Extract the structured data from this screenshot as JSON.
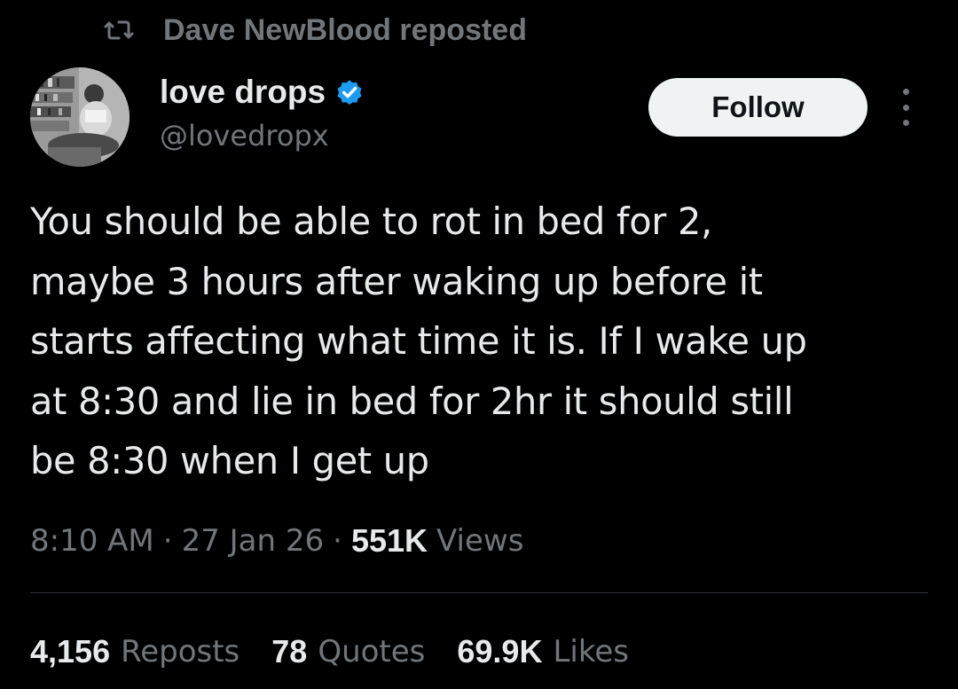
{
  "repost": {
    "icon": "repost-icon",
    "text": "Dave NewBlood reposted"
  },
  "author": {
    "name": "love drops",
    "handle": "@lovedropx",
    "verified": true,
    "verified_color": "#1d9bf0",
    "avatar_icon": "avatar-photo"
  },
  "follow_label": "Follow",
  "more_icon": "more-vertical-icon",
  "tweet": {
    "text": "You should be able to rot in bed for 2,\nmaybe 3 hours after waking up before it\nstarts affecting what time it is. If I wake up\nat 8:30 and lie in bed for 2hr it should still\nbe 8:30 when I get up"
  },
  "meta": {
    "time": "8:10 AM",
    "sep1": "·",
    "date": "27 Jan 26",
    "sep2": "·",
    "views_count": "551K",
    "views_label": "Views"
  },
  "stats": {
    "reposts_count": "4,156",
    "reposts_label": "Reposts",
    "quotes_count": "78",
    "quotes_label": "Quotes",
    "likes_count": "69.9K",
    "likes_label": "Likes"
  },
  "colors": {
    "background": "#000000",
    "primary_text": "#e7e9ea",
    "secondary_text": "#71767b",
    "divider": "#2f3336",
    "follow_bg": "#eff3f4",
    "verified": "#1d9bf0"
  }
}
